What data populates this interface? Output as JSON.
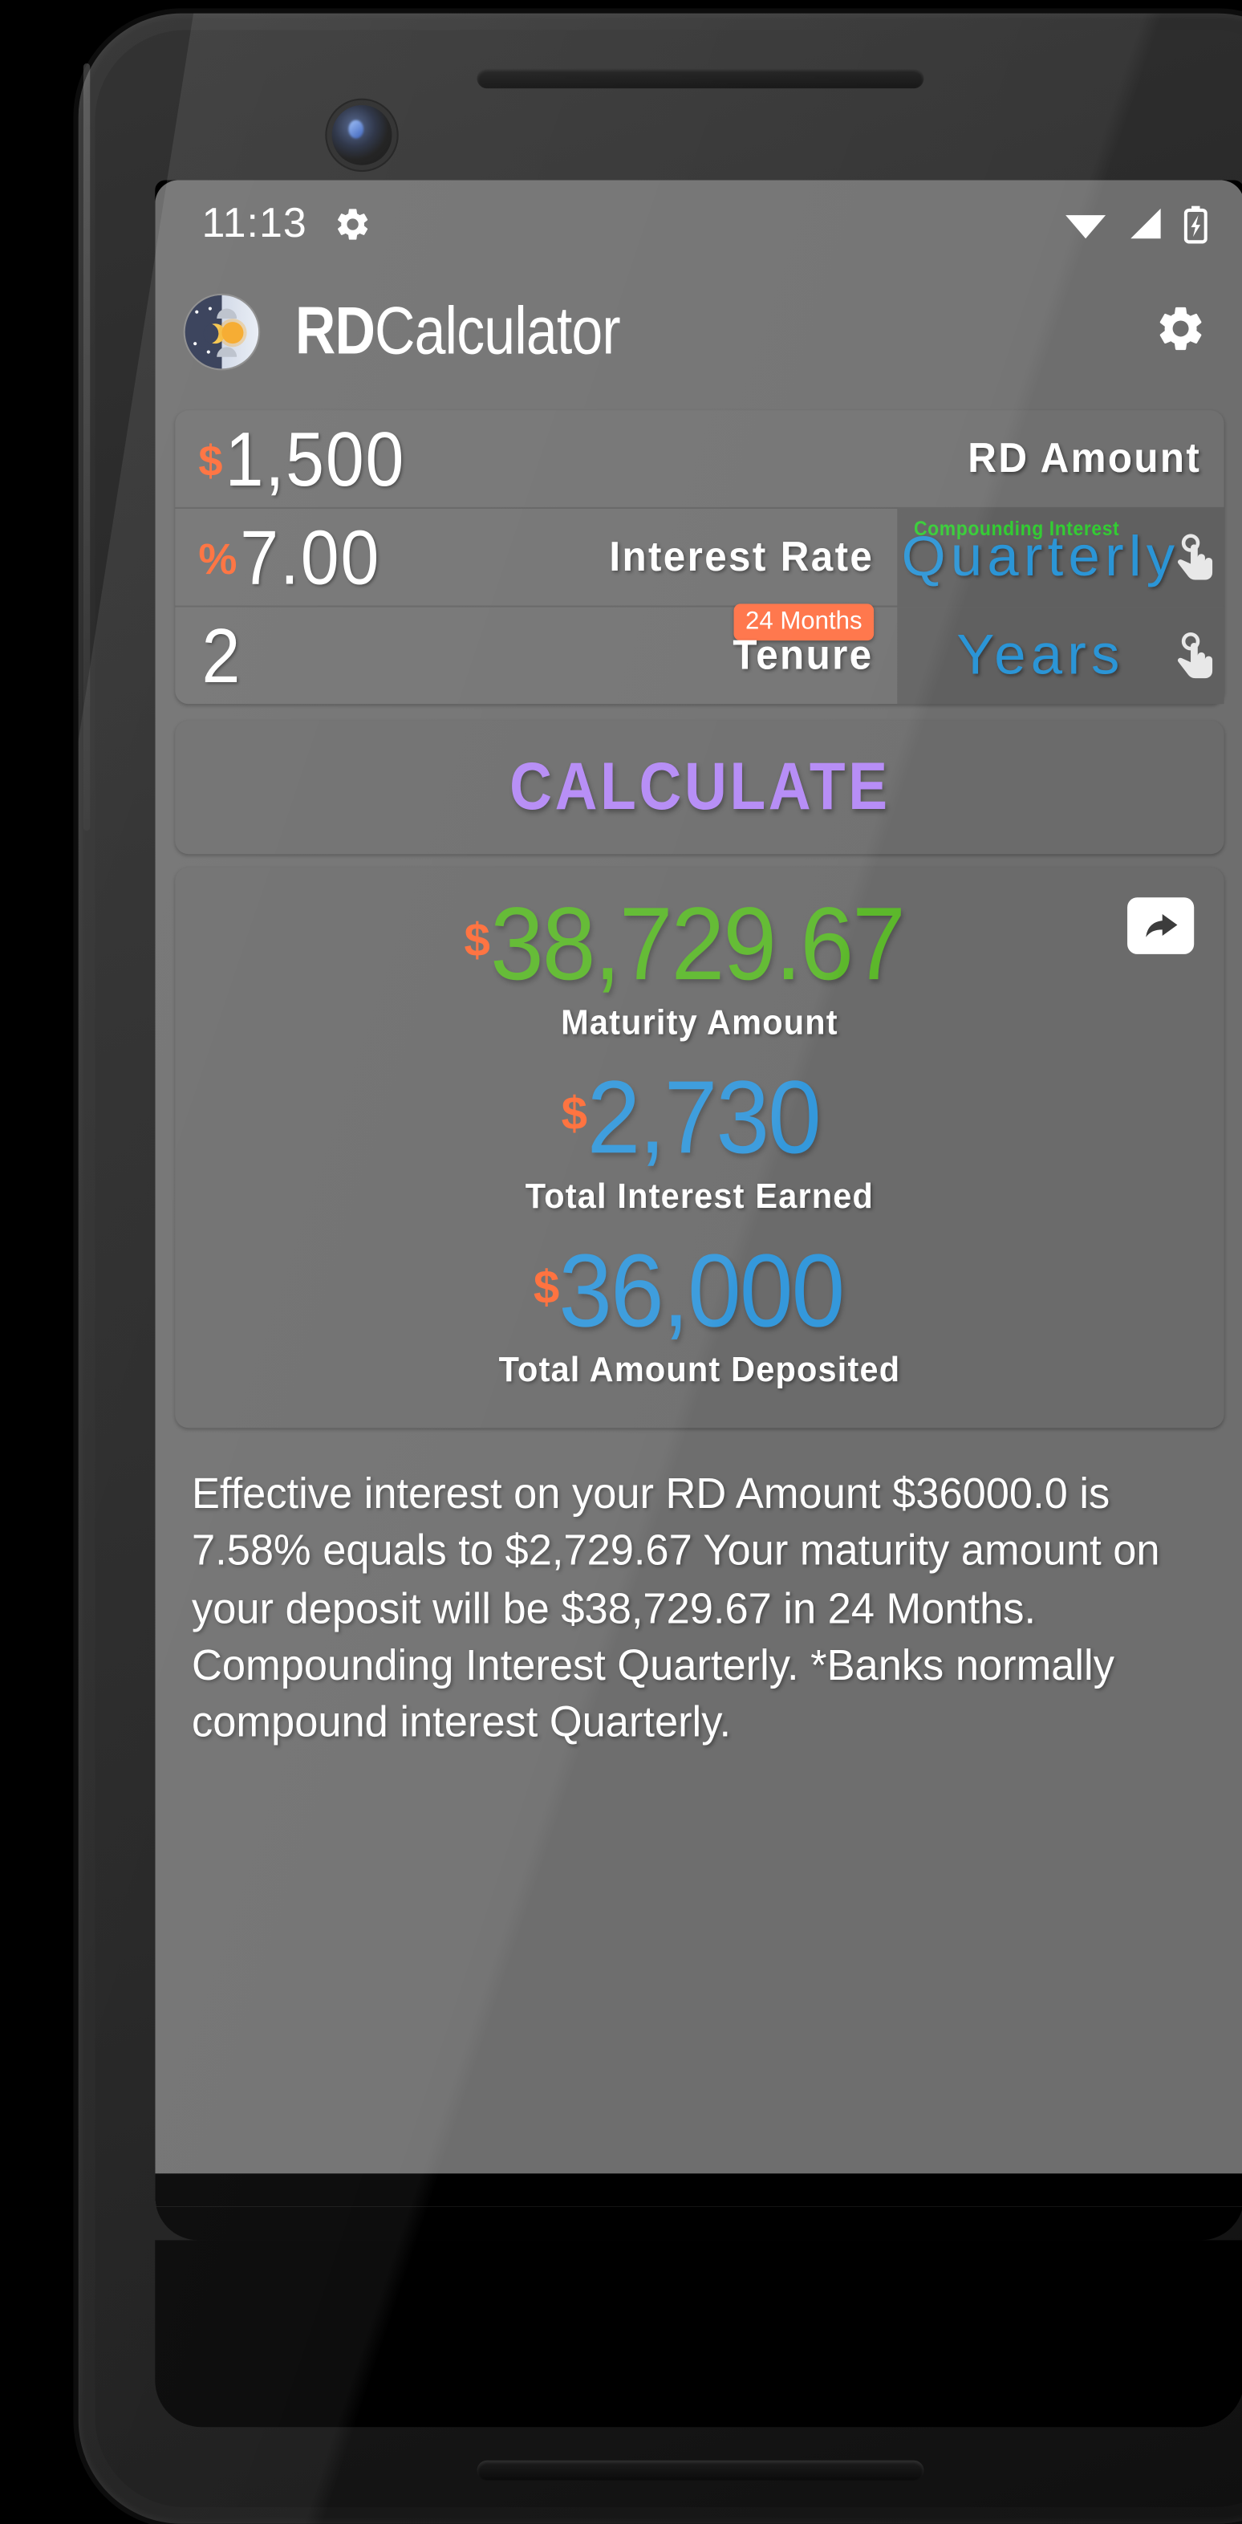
{
  "status_bar": {
    "time": "11:13",
    "icons": [
      "gear-icon",
      "wifi-icon",
      "cellular-signal-icon",
      "battery-charging-icon"
    ]
  },
  "app_bar": {
    "brand_icon": "day-night-toggle-icon",
    "title_bold": "RD",
    "title_rest": "Calculator",
    "settings_icon": "gear-icon"
  },
  "inputs": {
    "rd_amount": {
      "symbol": "$",
      "value": "1,500",
      "label": "RD Amount"
    },
    "interest_rate": {
      "symbol": "%",
      "value": "7.00",
      "label": "Interest Rate",
      "option_caption": "Compounding Interest",
      "option_value": "Quarterly",
      "option_icon": "touch-tap-icon"
    },
    "tenure": {
      "symbol": "",
      "value": "2",
      "label": "Tenure",
      "badge": "24 Months",
      "option_value": "Years",
      "option_icon": "touch-tap-icon"
    }
  },
  "calculate_button": {
    "label": "CALCULATE"
  },
  "results": {
    "share_icon": "share-icon",
    "items": [
      {
        "symbol": "$",
        "value": "38,729.67",
        "label": "Maturity Amount",
        "color": "green"
      },
      {
        "symbol": "$",
        "value": "2,730",
        "label": "Total Interest Earned",
        "color": "blue"
      },
      {
        "symbol": "$",
        "value": "36,000",
        "label": "Total Amount Deposited",
        "color": "blue"
      }
    ]
  },
  "description": {
    "text": "Effective interest on your RD Amount $36000.0 is 7.58% equals to $2,729.67 Your maturity amount on your deposit will be $38,729.67 in 24 Months. Compounding Interest Quarterly. *Banks normally compound interest Quarterly."
  },
  "colors": {
    "accent_orange": "#ff6b35",
    "accent_blue": "#3498db",
    "accent_green": "#5cb82b",
    "accent_purple": "#b388f5",
    "badge_orange": "#ff7043",
    "caption_green": "#33cc33",
    "app_background": "#6e6e6e",
    "card_background": "#6b6b6b"
  }
}
